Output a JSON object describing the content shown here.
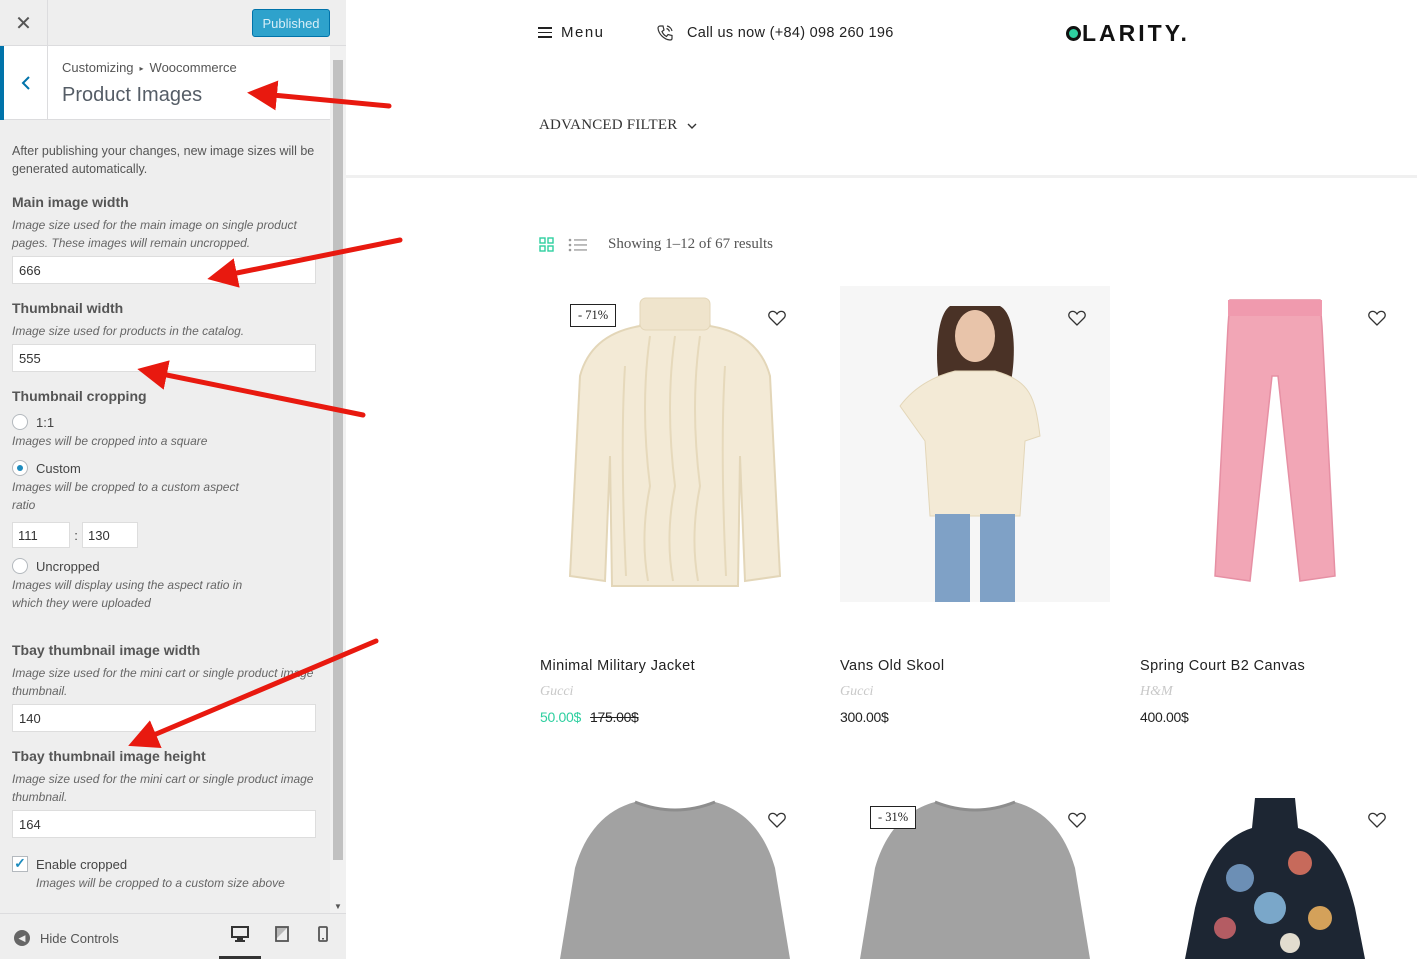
{
  "customizer": {
    "publish_label": "Published",
    "breadcrumb": {
      "root": "Customizing",
      "parent": "Woocommerce"
    },
    "section_title": "Product Images",
    "note": "After publishing your changes, new image sizes will be generated automatically.",
    "main_image_width": {
      "title": "Main image width",
      "description": "Image size used for the main image on single product pages. These images will remain uncropped.",
      "value": "666"
    },
    "thumbnail_width": {
      "title": "Thumbnail width",
      "description": "Image size used for products in the catalog.",
      "value": "555"
    },
    "thumbnail_cropping": {
      "title": "Thumbnail cropping",
      "options": [
        {
          "label": "1:1",
          "description": "Images will be cropped into a square",
          "selected": false
        },
        {
          "label": "Custom",
          "description": "Images will be cropped to a custom aspect ratio",
          "selected": true
        },
        {
          "label": "Uncropped",
          "description": "Images will display using the aspect ratio in which they were uploaded",
          "selected": false
        }
      ],
      "ratio_width": "111",
      "ratio_height": "130",
      "ratio_separator": ":"
    },
    "tbay_thumb_width": {
      "title": "Tbay thumbnail image width",
      "description": "Image size used for the mini cart or single product image thumbnail.",
      "value": "140"
    },
    "tbay_thumb_height": {
      "title": "Tbay thumbnail image height",
      "description": "Image size used for the mini cart or single product image thumbnail.",
      "value": "164"
    },
    "enable_cropped": {
      "label": "Enable cropped",
      "description": "Images will be cropped to a custom size above",
      "checked": true
    },
    "footer": {
      "hide_controls_label": "Hide Controls",
      "active_device": "desktop"
    }
  },
  "site": {
    "menu_label": "Menu",
    "call_text": "Call us now (+84) 098 260 196",
    "logo_text": "LARITY.",
    "advanced_filter_label": "ADVANCED FILTER",
    "result_count": "Showing 1–12 of 67 results",
    "accent_color": "#2ecfa0",
    "products": [
      {
        "name": "Minimal Military Jacket",
        "brand": "Gucci",
        "sale_price": "50.00$",
        "regular_price": "175.00$",
        "badge": "- 71%",
        "image": "cream-cable-knit-sweater"
      },
      {
        "name": "Vans Old Skool",
        "brand": "Gucci",
        "price": "300.00$",
        "image": "model-in-cream-sweater"
      },
      {
        "name": "Spring Court B2 Canvas",
        "brand": "H&M",
        "price": "400.00$",
        "image": "pink-trousers"
      },
      {
        "badge": "",
        "image": "grey-sweater"
      },
      {
        "badge": "- 31%",
        "image": "grey-sweater"
      },
      {
        "badge": "",
        "image": "floral-blouse"
      }
    ]
  }
}
